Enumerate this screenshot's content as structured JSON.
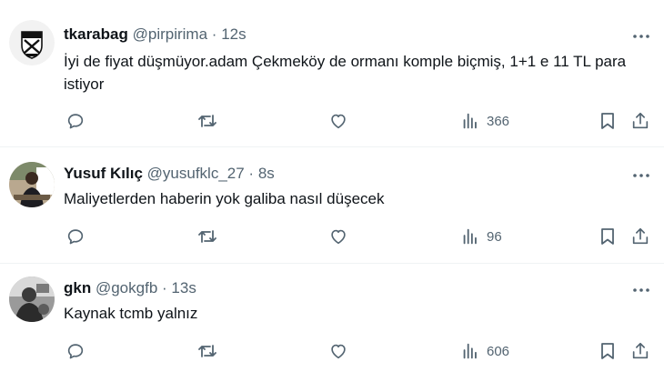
{
  "colors": {
    "text": "#0f1419",
    "secondary": "#536471",
    "divider": "#eff3f4"
  },
  "tweets": [
    {
      "name": "tkarabag",
      "handle": "@pirpirima",
      "separator": "·",
      "time": "12s",
      "text": "İyi de fiyat düşmüyor.adam Çekmeköy de ormanı komple biçmiş, 1+1 e 11 TL para istiyor",
      "views": "366",
      "avatar": "crest-avatar"
    },
    {
      "name": "Yusuf Kılıç",
      "handle": "@yusufklc_27",
      "separator": "·",
      "time": "8s",
      "text": "Maliyetlerden haberin yok galiba nasıl düşecek",
      "views": "96",
      "avatar": "photo-avatar"
    },
    {
      "name": "gkn",
      "handle": "@gokgfb",
      "separator": "·",
      "time": "13s",
      "text": "Kaynak tcmb yalnız",
      "views": "606",
      "avatar": "grayscale-photo-avatar"
    }
  ],
  "icons": {
    "more": "more-dots-icon",
    "reply": "reply-icon",
    "retweet": "retweet-icon",
    "like": "like-icon",
    "views": "views-icon",
    "bookmark": "bookmark-icon",
    "share": "share-icon"
  }
}
